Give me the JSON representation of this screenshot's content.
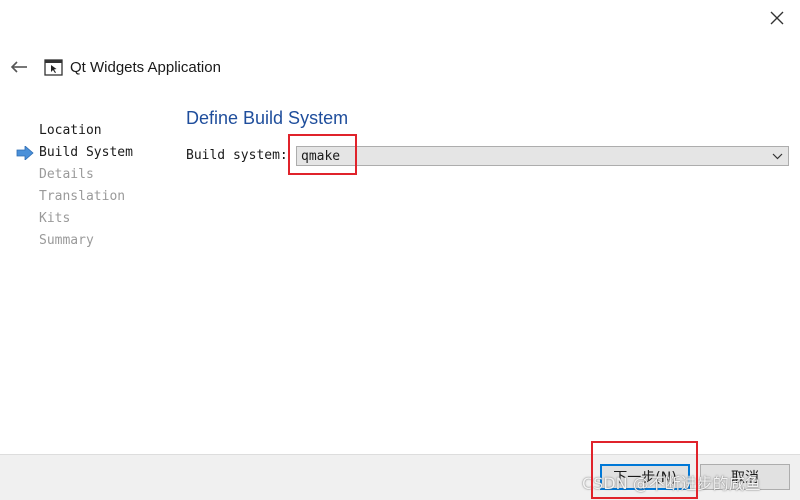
{
  "window": {
    "close_icon": "close-icon"
  },
  "header": {
    "back_icon": "back-arrow-icon",
    "app_icon": "qt-application-icon",
    "title": "Qt Widgets Application"
  },
  "steps": [
    {
      "label": "Location",
      "state": "done"
    },
    {
      "label": "Build System",
      "state": "current"
    },
    {
      "label": "Details",
      "state": "pending"
    },
    {
      "label": "Translation",
      "state": "pending"
    },
    {
      "label": "Kits",
      "state": "pending"
    },
    {
      "label": "Summary",
      "state": "pending"
    }
  ],
  "page": {
    "title": "Define Build System",
    "build_system_label": "Build system:",
    "build_system_value": "qmake"
  },
  "footer": {
    "next_label": "下一步(N)",
    "cancel_label": "取消"
  },
  "watermark": "CSDN @不断进步的咸鱼",
  "colors": {
    "accent_title": "#1f4e9c",
    "annotation_red": "#e0232b",
    "focus_blue": "#0078d7",
    "current_step_arrow": "#4a90d9"
  }
}
